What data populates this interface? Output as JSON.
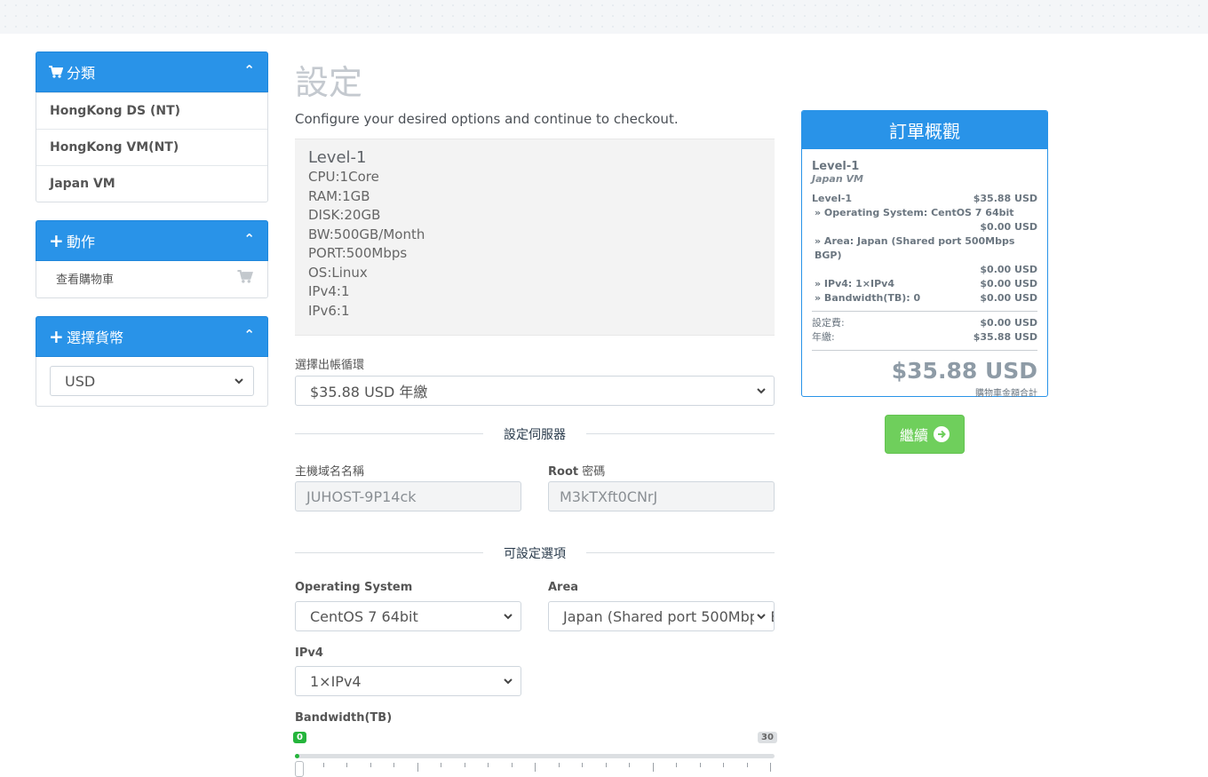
{
  "sidebar": {
    "categories": {
      "title": "分類",
      "items": [
        "HongKong DS (NT)",
        "HongKong VM(NT)",
        "Japan VM"
      ]
    },
    "actions": {
      "title": "動作",
      "items": [
        "查看購物車"
      ]
    },
    "currency": {
      "title": "選擇貨幣",
      "selected": "USD"
    }
  },
  "main": {
    "title": "設定",
    "subtitle": "Configure your desired options and continue to checkout.",
    "product": {
      "name": "Level-1",
      "lines": [
        "CPU:1Core",
        "RAM:1GB",
        "DISK:20GB",
        "BW:500GB/Month",
        "PORT:500Mbps",
        "OS:Linux",
        "IPv4:1",
        "IPv6:1"
      ]
    },
    "billing": {
      "label": "選擇出帳循環",
      "selected": "$35.88 USD 年繳"
    },
    "server_section": "設定伺服器",
    "hostname": {
      "label": "主機域名名稱",
      "value": "JUHOST-9P14ck"
    },
    "root_password": {
      "label_bold": "Root",
      "label_rest": " 密碼",
      "value": "M3kTXft0CNrJ"
    },
    "options_section": "可設定選項",
    "os": {
      "label": "Operating System",
      "selected": "CentOS 7 64bit"
    },
    "area": {
      "label": "Area",
      "selected": "Japan (Shared port 500Mbps BGP)"
    },
    "ipv4": {
      "label": "IPv4",
      "selected": "1×IPv4"
    },
    "bandwidth": {
      "label": "Bandwidth(TB)",
      "min": "0",
      "max": "30",
      "value": 0
    }
  },
  "summary": {
    "title": "訂單概觀",
    "product": "Level-1",
    "group": "Japan VM",
    "base_label": "Level-1",
    "base_price": "$35.88 USD",
    "options": [
      {
        "label": "» Operating System: CentOS 7 64bit",
        "price": "$0.00 USD"
      },
      {
        "label": "» Area: Japan (Shared port 500Mbps BGP)",
        "price": "$0.00 USD"
      },
      {
        "label": "» IPv4: 1×IPv4",
        "price": "$0.00 USD"
      },
      {
        "label": "» Bandwidth(TB): 0",
        "price": "$0.00 USD"
      }
    ],
    "setup_label": "設定費:",
    "setup_price": "$0.00 USD",
    "annual_label": "年繳:",
    "annual_price": "$35.88 USD",
    "total": "$35.88 USD",
    "total_note": "購物車金額合計"
  },
  "continue_label": "繼續",
  "colors": {
    "primary": "#2993e8",
    "success": "#6fcf5c",
    "slider_fill": "#25b53c"
  }
}
